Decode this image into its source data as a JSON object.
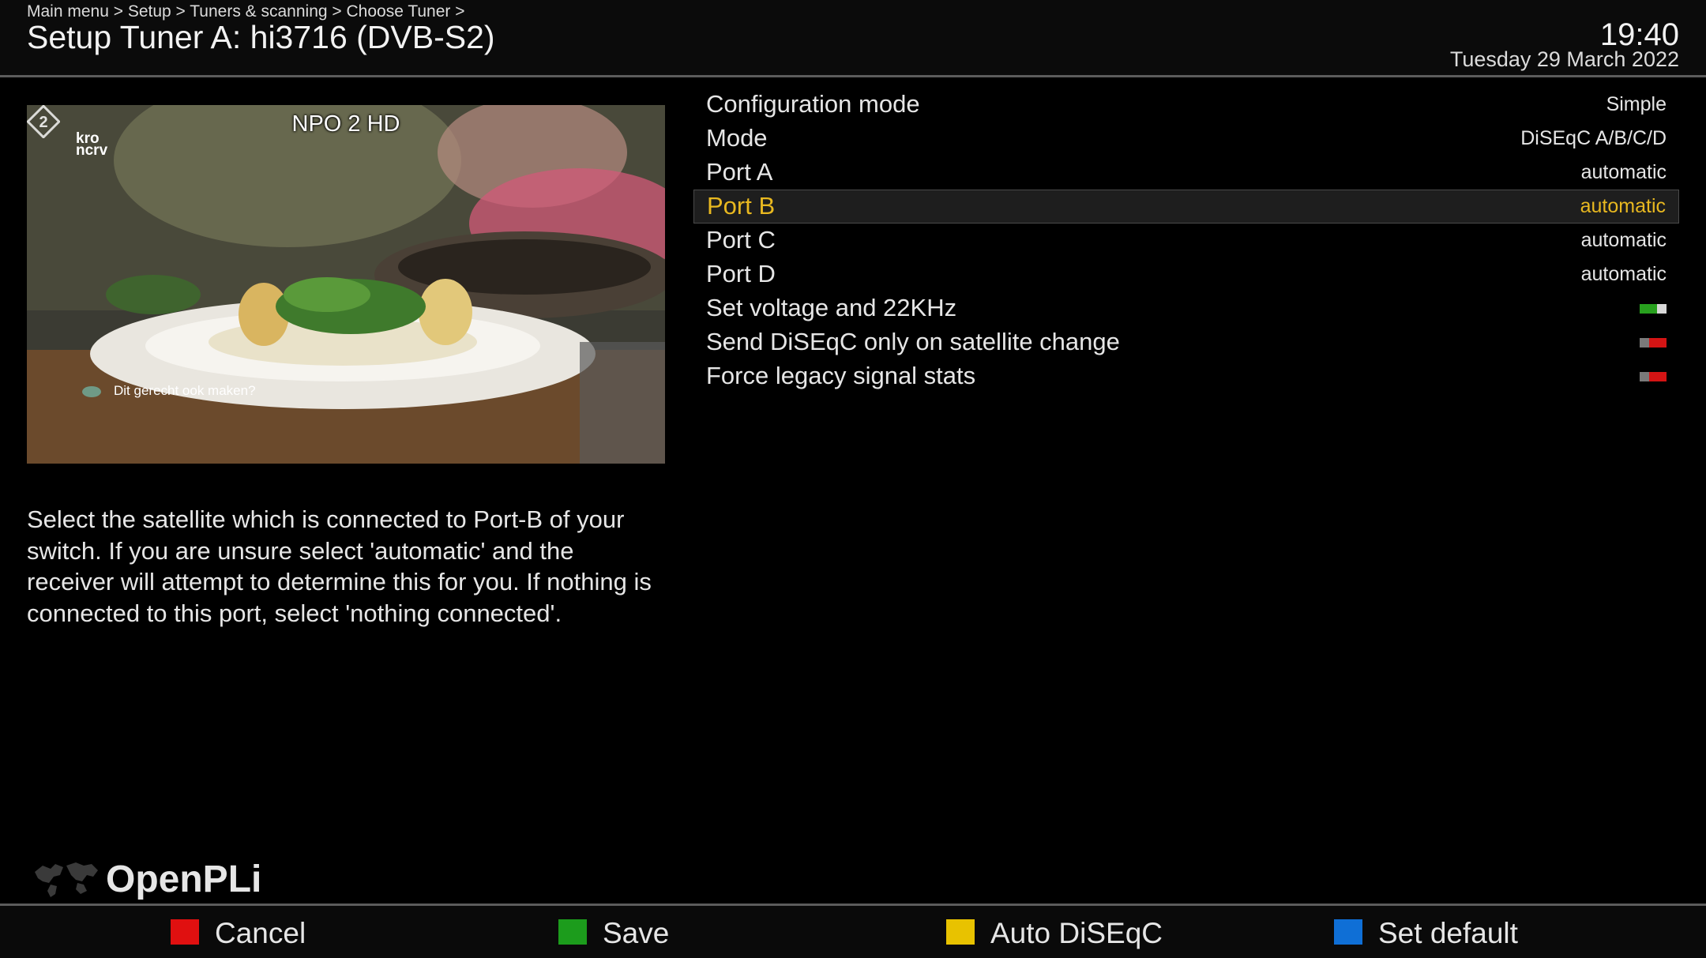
{
  "header": {
    "breadcrumb": "Main menu > Setup > Tuners & scanning > Choose Tuner >",
    "title": "Setup Tuner A: hi3716 (DVB-S2)",
    "time": "19:40",
    "date": "Tuesday 29 March 2022"
  },
  "preview": {
    "channel": "NPO 2 HD",
    "logo_left": "kro ncrv",
    "logo_right": "2",
    "overlay_hint": "Dit gerecht ook maken?"
  },
  "description": "Select the satellite which is connected to Port-B of your switch. If you are unsure select 'automatic' and the receiver will attempt to determine this for you. If nothing is connected to this port, select 'nothing connected'.",
  "config": {
    "rows": [
      {
        "label": "Configuration mode",
        "value": "Simple"
      },
      {
        "label": "Mode",
        "value": "DiSEqC A/B/C/D"
      },
      {
        "label": "Port A",
        "value": "automatic"
      },
      {
        "label": "Port B",
        "value": "automatic",
        "selected": true
      },
      {
        "label": "Port C",
        "value": "automatic"
      },
      {
        "label": "Port D",
        "value": "automatic"
      },
      {
        "label": "Set voltage and 22KHz",
        "toggle": true
      },
      {
        "label": "Send DiSEqC only on satellite change",
        "toggle": false
      },
      {
        "label": "Force legacy signal stats",
        "toggle": false
      }
    ]
  },
  "brand": {
    "name": "OpenPLi"
  },
  "footer": {
    "buttons": [
      {
        "label": "Cancel",
        "color": "#e01010"
      },
      {
        "label": "Save",
        "color": "#1c9c1c"
      },
      {
        "label": "Auto DiSEqC",
        "color": "#e8c200"
      },
      {
        "label": "Set default",
        "color": "#0f6fd6"
      }
    ]
  },
  "colors": {
    "selected_text": "#e8b820",
    "toggle_on": "#28a01e",
    "toggle_off": "#d41414"
  }
}
